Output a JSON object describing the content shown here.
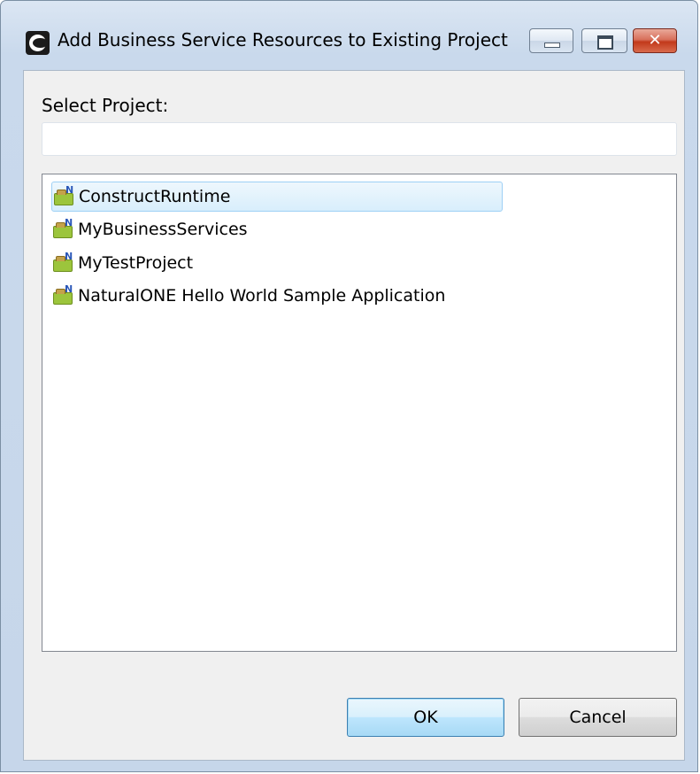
{
  "window": {
    "title": "Add Business Service Resources to Existing Project",
    "close_glyph": "✕"
  },
  "form": {
    "select_label": "Select Project:",
    "filter_value": "",
    "filter_placeholder": ""
  },
  "projects": [
    {
      "label": "ConstructRuntime",
      "selected": true,
      "icon": "natural-project-folder-icon"
    },
    {
      "label": "MyBusinessServices",
      "selected": false,
      "icon": "natural-project-folder-icon"
    },
    {
      "label": "MyTestProject",
      "selected": false,
      "icon": "natural-project-folder-icon"
    },
    {
      "label": "NaturalONE Hello World Sample Application",
      "selected": false,
      "icon": "natural-project-folder-icon"
    }
  ],
  "project_icon_letter": "N",
  "buttons": {
    "ok_label": "OK",
    "cancel_label": "Cancel"
  },
  "colors": {
    "selection_border": "#9ed0f5",
    "default_button_border": "#3c7fb1"
  }
}
